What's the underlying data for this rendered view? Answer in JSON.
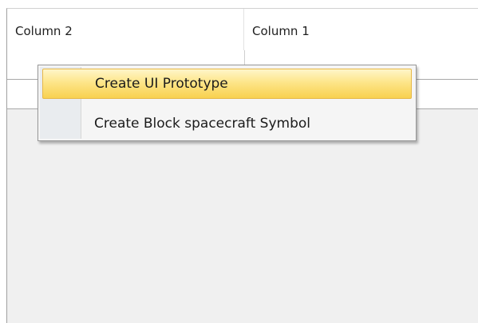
{
  "table": {
    "columns": [
      "Column 2",
      "Column 1"
    ]
  },
  "context_menu": {
    "items": [
      {
        "label": "Create UI Prototype",
        "highlighted": true
      },
      {
        "label": "Create Block spacecraft Symbol",
        "highlighted": false
      }
    ],
    "highlight_color": "#f8d14f"
  }
}
